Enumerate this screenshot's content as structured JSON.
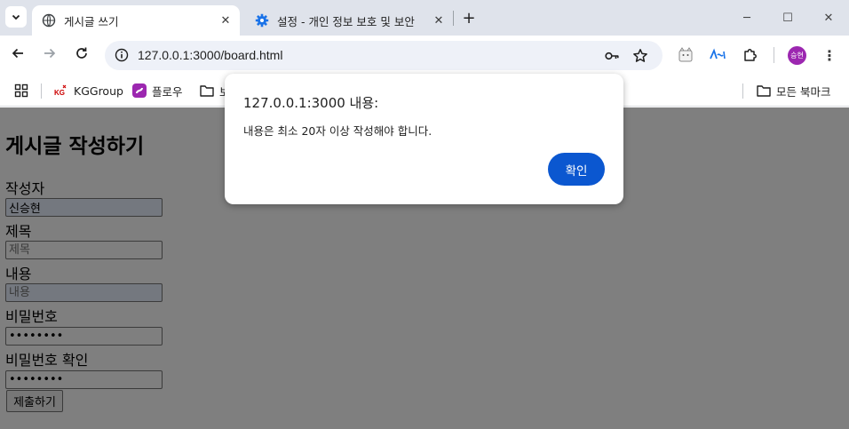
{
  "browser": {
    "tabs": [
      {
        "title": "게시글 쓰기",
        "icon": "globe-icon",
        "active": true
      },
      {
        "title": "설정 - 개인 정보 보호 및 보안",
        "icon": "gear-icon",
        "active": false
      }
    ],
    "url": "127.0.0.1:3000/board.html",
    "profile_initials": "승현",
    "accent_color": "#0b57d0",
    "profile_color": "#9c27b0"
  },
  "bookmarks": {
    "items": [
      {
        "label": "KGGroup",
        "icon": "kg-logo-icon"
      },
      {
        "label": "플로우",
        "icon": "flow-logo-icon"
      },
      {
        "label": "보",
        "icon": "folder-icon"
      }
    ],
    "all_bookmarks_label": "모든 북마크"
  },
  "page": {
    "heading": "게시글 작성하기",
    "fields": [
      {
        "label": "작성자",
        "value": "신승현",
        "placeholder": ""
      },
      {
        "label": "제목",
        "value": "",
        "placeholder": "제목"
      },
      {
        "label": "내용",
        "value": "",
        "placeholder": "내용"
      },
      {
        "label": "비밀번호",
        "value": "••••••••",
        "placeholder": ""
      },
      {
        "label": "비밀번호 확인",
        "value": "••••••••",
        "placeholder": ""
      }
    ],
    "submit_label": "제출하기"
  },
  "dialog": {
    "title": "127.0.0.1:3000 내용:",
    "message": "내용은 최소 20자 이상 작성해야 합니다.",
    "ok_label": "확인"
  }
}
